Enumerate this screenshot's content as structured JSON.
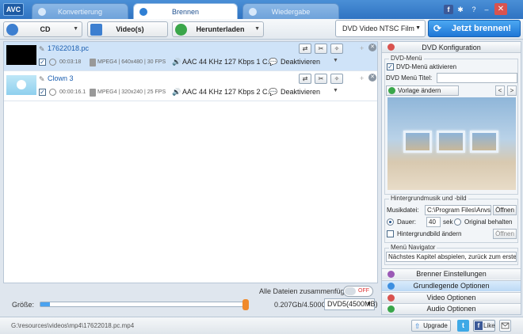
{
  "titlebar": {
    "logo": "AVC",
    "tabs": [
      {
        "label": "Konvertierung",
        "active": false
      },
      {
        "label": "Brennen",
        "active": true
      },
      {
        "label": "Wiedergabe",
        "active": false
      }
    ],
    "icons": [
      "facebook-icon",
      "gear-icon",
      "help-icon",
      "minimize-icon",
      "close-icon"
    ],
    "facebook_glyph": "f",
    "gear_glyph": "✱",
    "help_glyph": "?",
    "minimize_glyph": "–",
    "close_glyph": "✕"
  },
  "toolbar": {
    "source_label": "CD",
    "video_label": "Video(s)",
    "download_label": "Herunterladen",
    "dropdown_glyph": "▼",
    "format_value": "DVD Video NTSC Film",
    "burn_label": "Jetzt brennen!",
    "burn_glyph": "⟳"
  },
  "files": [
    {
      "name": "17622018.pc",
      "checked": true,
      "duration": "00:03:18",
      "info": "MPEG4 | 640x480 | 30 FPS",
      "audio": "AAC 44 KHz 127 Kbps 1 C...",
      "subtitle": "Deaktivieren",
      "selected": true
    },
    {
      "name": "Clown 3",
      "checked": true,
      "duration": "00:00:16.1",
      "info": "MPEG4 | 320x240 | 25 FPS",
      "audio": "AAC 44 KHz 127 Kbps 2 C...",
      "subtitle": "Deaktivieren",
      "selected": false
    }
  ],
  "row_glyphs": {
    "edit": "✎",
    "check": "✓",
    "audio": "🔊",
    "subtitle": "💬",
    "dropdown": "▼",
    "rotate": "⇄",
    "cut": "✂",
    "effects": "✧",
    "plus": "+",
    "close": "✕"
  },
  "bottom": {
    "merge_label": "Alle Dateien zusammenfügen",
    "merge_state": "OFF",
    "size_label": "Größe:",
    "size_value": "0.207Gb/4.500Gb",
    "size_fraction": 0.046,
    "disc_value": "DVD5(4500MB)"
  },
  "panel": {
    "title": "DVD Konfiguration",
    "dvd_menu_group": "DVD-Menü",
    "enable_menu_label": "DVD-Menü aktivieren",
    "enable_menu_checked": true,
    "menu_title_label": "DVD Menü Titel:",
    "menu_title_value": "",
    "template_label": "Vorlage ändern",
    "prev_glyph": "<",
    "next_glyph": ">",
    "music_group": "Hintergrundmusik und -bild",
    "music_file_label": "Musikdatei:",
    "music_file_value": "C:\\Program Files\\Anvso",
    "open_label": "Öffnen",
    "duration_label": "Dauer:",
    "duration_value": "40",
    "duration_unit": "sek",
    "keep_original_label": "Original behalten",
    "bg_image_label": "Hintergrundbild ändern",
    "bg_image_checked": false,
    "open_label_2": "Öffnen",
    "navigator_group": "Menü Navigator",
    "navigator_value": "Nächstes Kapitel abspielen, zurück zum erster",
    "sections": [
      {
        "label": "Brenner Einstellungen",
        "active": false
      },
      {
        "label": "Grundlegende Optionen",
        "active": true
      },
      {
        "label": "Video Optionen",
        "active": false
      },
      {
        "label": "Audio Optionen",
        "active": false
      }
    ]
  },
  "status": {
    "path": "G:\\resources\\videos\\mp4\\17622018.pc.mp4",
    "upgrade_label": "Upgrade",
    "upgrade_glyph": "⇧",
    "twitter_glyph": "t",
    "fb_glyph": "f",
    "like_label": "Like"
  },
  "colors": {
    "accent": "#2f73c2",
    "burn_button": "#1f77d6",
    "selected_row": "#cfe3f8"
  }
}
